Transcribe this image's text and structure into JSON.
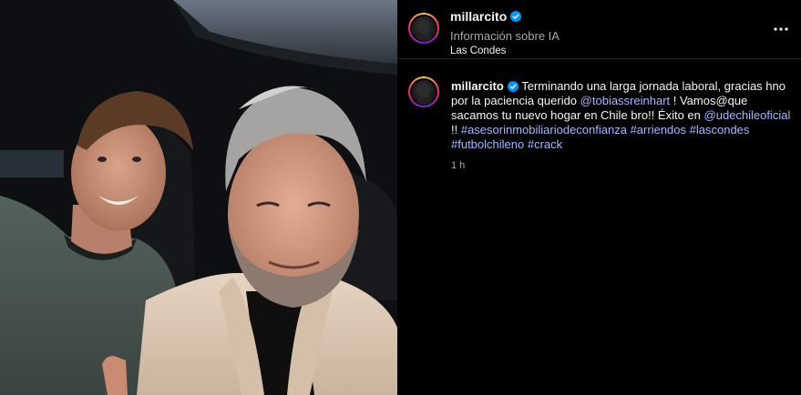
{
  "post": {
    "username": "millarcito",
    "ai_info": "Información sobre IA",
    "location": "Las Condes",
    "caption": {
      "intro": "Terminando una larga jornada laboral, gracias hno por la paciencia querido",
      "mention1": "@tobiassreinhart",
      "mid1": " ! Vamos@que sacamos tu nuevo hogar en Chile bro!! Éxito en",
      "mention2": "@udechileoficial",
      "mid2": " !! ",
      "hashtags": [
        "#asesorinmobiliariodeconfianza",
        "#arriendos",
        "#lascondes",
        "#futbolchileno",
        "#crack"
      ]
    },
    "timestamp": "1 h"
  },
  "icons": {
    "verified": "verified-badge-icon",
    "more": "more-options-icon"
  },
  "colors": {
    "link": "#a6b8ff",
    "verified": "#0095f6",
    "background": "#000000",
    "secondary_text": "#a8a8a8"
  }
}
